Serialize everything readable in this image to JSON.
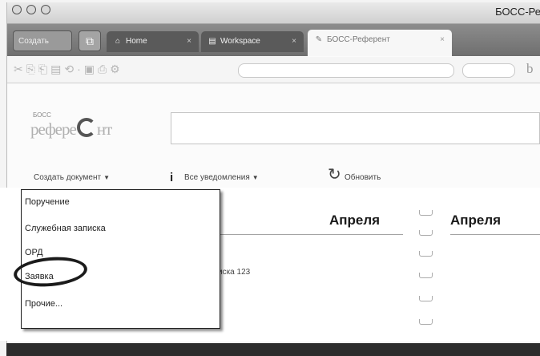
{
  "window": {
    "title": "БОСС-Ре"
  },
  "tabbar": {
    "create_label": "Создать",
    "tabs": [
      {
        "label": "Home"
      },
      {
        "label": "Workspace"
      },
      {
        "label": "БОСС-Референт"
      }
    ]
  },
  "app": {
    "logo_small": "БОСС",
    "logo_text_start": "рефере",
    "logo_text_end": "нт"
  },
  "actions": {
    "create_document": "Создать документ",
    "all_notifications": "Все уведомления",
    "refresh": "Обновить"
  },
  "dropdown": {
    "items": [
      "Поручение",
      "Служебная записка",
      "ОРД",
      "Заявка",
      "Прочие..."
    ]
  },
  "content": {
    "header1": "Апреля",
    "header2": "Апреля",
    "row1_text": "иска 123"
  }
}
